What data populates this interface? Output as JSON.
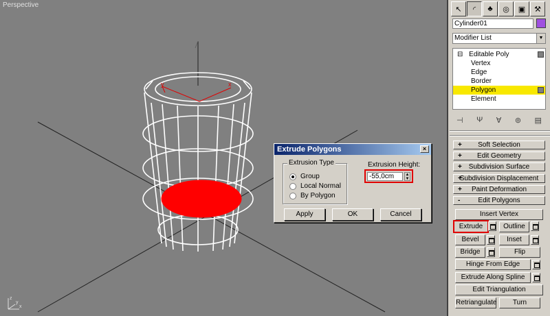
{
  "viewport": {
    "label": "Perspective"
  },
  "dialog": {
    "title": "Extrude Polygons",
    "close_icon": "close-icon",
    "extrusion_type_label": "Extrusion Type",
    "options": [
      "Group",
      "Local Normal",
      "By Polygon"
    ],
    "selected_option": "Group",
    "height_label": "Extrusion Height:",
    "height_value": "-55,0cm",
    "apply_label": "Apply",
    "ok_label": "OK",
    "cancel_label": "Cancel"
  },
  "panel": {
    "object_name": "Cylinder01",
    "object_color": "#a050e0",
    "modifier_list": "Modifier List",
    "stack": [
      {
        "label": "Editable Poly"
      },
      {
        "label": "Vertex"
      },
      {
        "label": "Edge"
      },
      {
        "label": "Border"
      },
      {
        "label": "Polygon"
      },
      {
        "label": "Element"
      }
    ],
    "selected_level": "Polygon",
    "rollouts": [
      {
        "sign": "+",
        "label": "Soft Selection"
      },
      {
        "sign": "+",
        "label": "Edit Geometry"
      },
      {
        "sign": "+",
        "label": "Subdivision Surface"
      },
      {
        "sign": "+",
        "label": "Subdivision Displacement"
      },
      {
        "sign": "+",
        "label": "Paint Deformation"
      },
      {
        "sign": "-",
        "label": "Edit Polygons"
      }
    ],
    "edit_polygons": {
      "insert_vertex": "Insert Vertex",
      "extrude": "Extrude",
      "outline": "Outline",
      "bevel": "Bevel",
      "inset": "Inset",
      "bridge": "Bridge",
      "flip": "Flip",
      "hinge": "Hinge From Edge",
      "extrude_spline": "Extrude Along Spline",
      "edit_tri": "Edit Triangulation",
      "retri": "Retriangulate",
      "turn": "Turn"
    }
  },
  "colors": {
    "selection": "#e00000",
    "highlight": "#f8e800",
    "viewport_bg": "#808080"
  }
}
